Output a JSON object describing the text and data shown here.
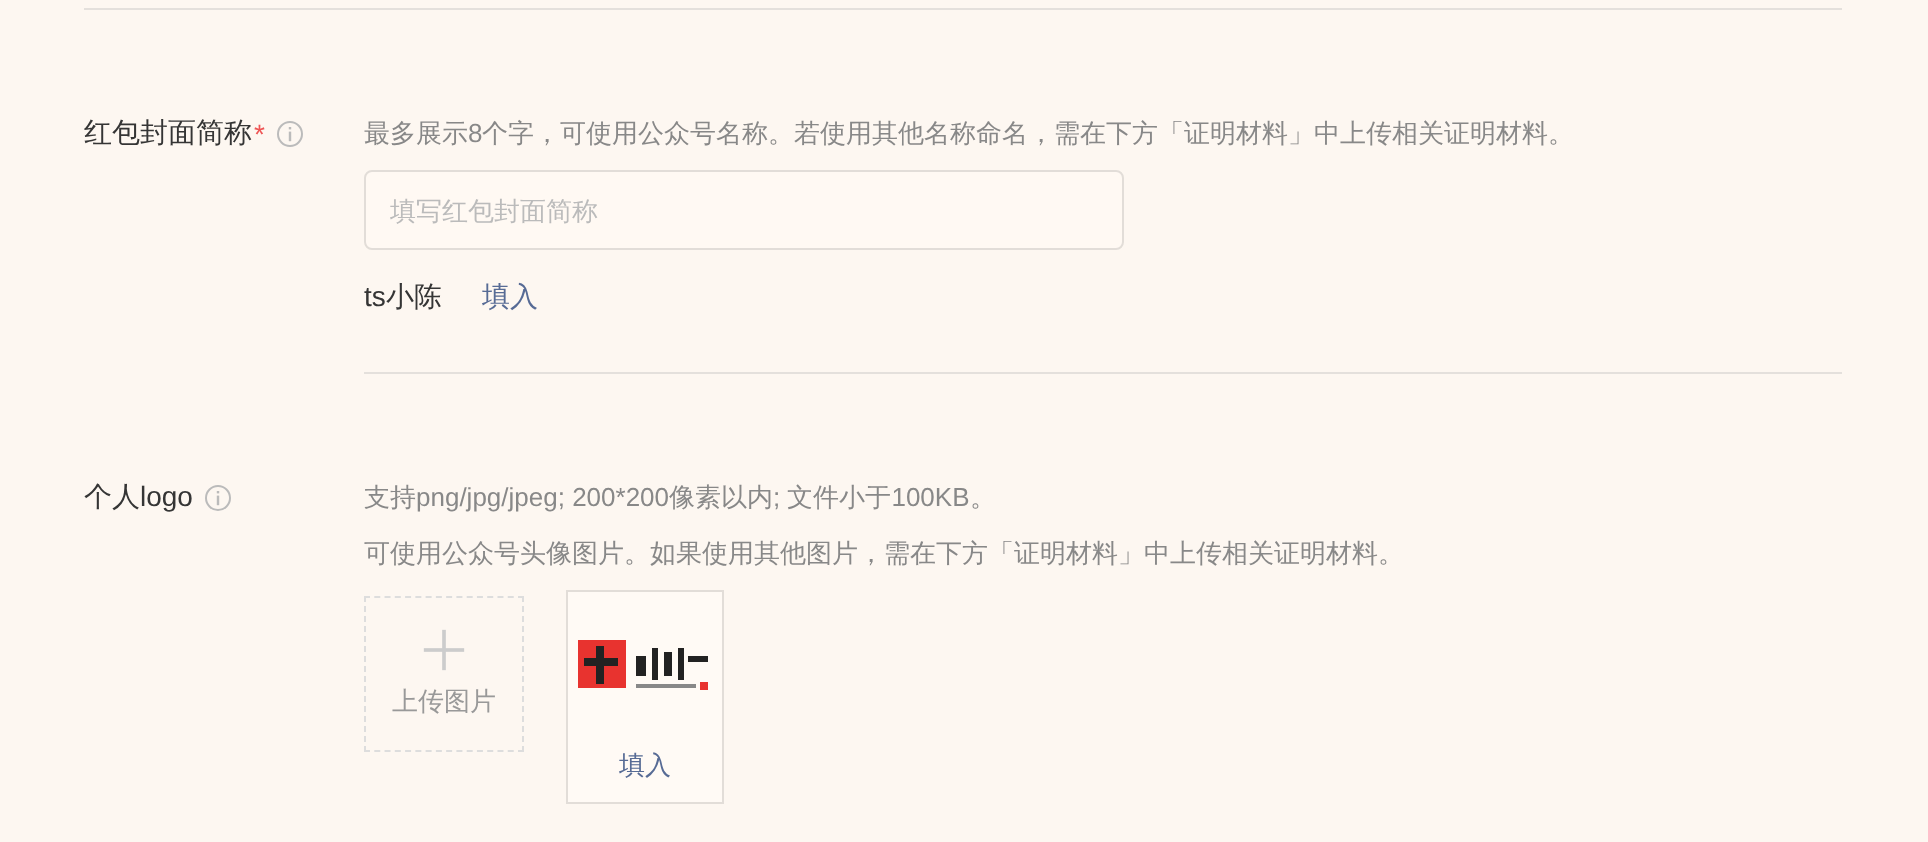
{
  "fields": [
    {
      "label": "红包封面简称",
      "required_mark": "*",
      "hints": [
        "最多展示8个字，可使用公众号名称。若使用其他名称命名，需在下方「证明材料」中上传相关证明材料。"
      ],
      "kind": "text",
      "placeholder": "填写红包封面简称",
      "suggestion": {
        "value": "ts小陈",
        "action": "填入"
      }
    },
    {
      "label": "个人logo",
      "hints": [
        "支持png/jpg/jpeg; 200*200像素以内; 文件小于100KB。",
        "可使用公众号头像图片。如果使用其他图片，需在下方「证明材料」中上传相关证明材料。"
      ],
      "upload": "上传图片",
      "suggestion": {
        "kind": "picture",
        "action": "填入"
      }
    }
  ]
}
